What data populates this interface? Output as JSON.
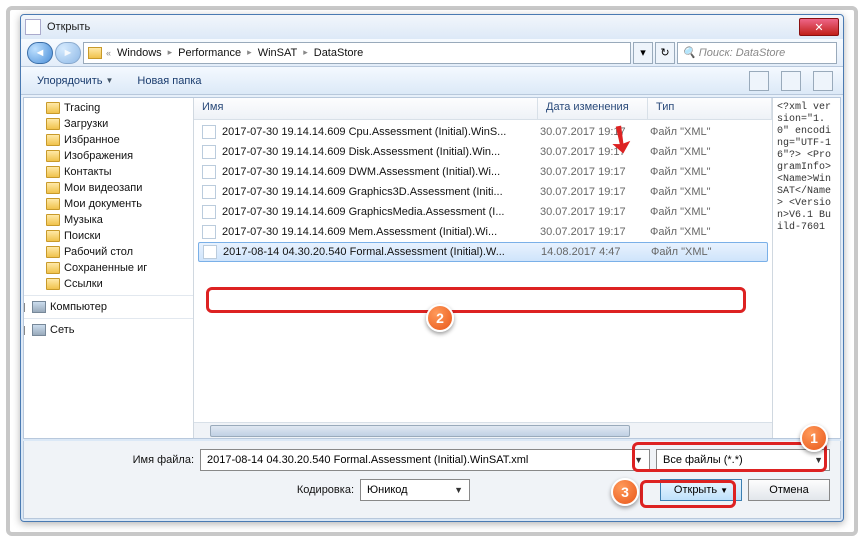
{
  "window": {
    "title": "Открыть"
  },
  "nav": {
    "segments": [
      "Windows",
      "Performance",
      "WinSAT",
      "DataStore"
    ],
    "search_placeholder": "Поиск: DataStore"
  },
  "toolbar": {
    "organize": "Упорядочить",
    "newfolder": "Новая папка"
  },
  "tree": {
    "items": [
      {
        "label": "Tracing",
        "icon": "folder",
        "level": 1
      },
      {
        "label": "Загрузки",
        "icon": "folder",
        "level": 1
      },
      {
        "label": "Избранное",
        "icon": "folder",
        "level": 1
      },
      {
        "label": "Изображения",
        "icon": "folder",
        "level": 1
      },
      {
        "label": "Контакты",
        "icon": "folder",
        "level": 1
      },
      {
        "label": "Мои видеозапи",
        "icon": "folder",
        "level": 1
      },
      {
        "label": "Мои документь",
        "icon": "folder",
        "level": 1
      },
      {
        "label": "Музыка",
        "icon": "folder",
        "level": 1
      },
      {
        "label": "Поиски",
        "icon": "folder",
        "level": 1
      },
      {
        "label": "Рабочий стол",
        "icon": "folder",
        "level": 1
      },
      {
        "label": "Сохраненные иг",
        "icon": "folder",
        "level": 1
      },
      {
        "label": "Ссылки",
        "icon": "folder",
        "level": 1
      },
      {
        "label": "Компьютер",
        "icon": "computer",
        "level": 0,
        "exp": "+",
        "sep": true
      },
      {
        "label": "Сеть",
        "icon": "computer",
        "level": 0,
        "exp": "+",
        "sep": true
      }
    ]
  },
  "columns": {
    "name": "Имя",
    "date": "Дата изменения",
    "type": "Тип"
  },
  "files": [
    {
      "name": "2017-07-30 19.14.14.609 Cpu.Assessment (Initial).WinS...",
      "date": "30.07.2017 19:17",
      "type": "Файл \"XML\""
    },
    {
      "name": "2017-07-30 19.14.14.609 Disk.Assessment (Initial).Win...",
      "date": "30.07.2017 19:17",
      "type": "Файл \"XML\""
    },
    {
      "name": "2017-07-30 19.14.14.609 DWM.Assessment (Initial).Wi...",
      "date": "30.07.2017 19:17",
      "type": "Файл \"XML\""
    },
    {
      "name": "2017-07-30 19.14.14.609 Graphics3D.Assessment (Initi...",
      "date": "30.07.2017 19:17",
      "type": "Файл \"XML\""
    },
    {
      "name": "2017-07-30 19.14.14.609 GraphicsMedia.Assessment (I...",
      "date": "30.07.2017 19:17",
      "type": "Файл \"XML\""
    },
    {
      "name": "2017-07-30 19.14.14.609 Mem.Assessment (Initial).Wi...",
      "date": "30.07.2017 19:17",
      "type": "Файл \"XML\""
    },
    {
      "name": "2017-08-14 04.30.20.540 Formal.Assessment (Initial).W...",
      "date": "14.08.2017 4:47",
      "type": "Файл \"XML\"",
      "selected": true
    }
  ],
  "preview": "<?xml version=\"1.0\" encoding=\"UTF-16\"?>\n<ProgramInfo>\n<Name>WinSAT</Name>\n<Version>V6.1 Build-7601",
  "footer": {
    "fname_label": "Имя файла:",
    "fname_value": "2017-08-14 04.30.20.540 Formal.Assessment (Initial).WinSAT.xml",
    "ftype_value": "Все файлы (*.*)",
    "enc_label": "Кодировка:",
    "enc_value": "Юникод",
    "open": "Открыть",
    "cancel": "Отмена"
  },
  "annot": {
    "b1": "1",
    "b2": "2",
    "b3": "3"
  }
}
